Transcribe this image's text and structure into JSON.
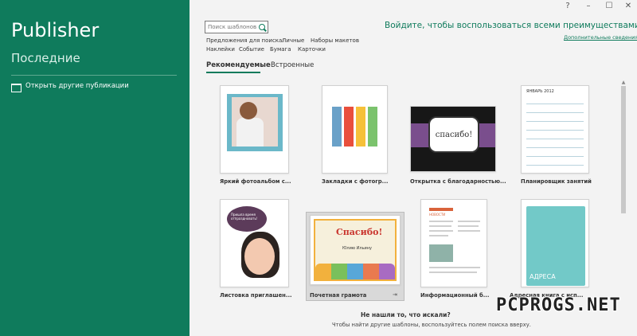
{
  "app": {
    "title": "Publisher",
    "recent_heading": "Последние",
    "open_other": "Открыть другие публикации"
  },
  "window": {
    "help": "?",
    "minimize": "–",
    "maximize": "☐",
    "close": "✕"
  },
  "search": {
    "placeholder": "Поиск шаблонов"
  },
  "signin": {
    "text": "Войдите, чтобы воспользоваться всеми преимуществами Office",
    "details_link": "Дополнительные сведения"
  },
  "suggestions": {
    "label": "Предложения для поиска:",
    "items": [
      "Личные",
      "Наборы макетов",
      "Наклейки",
      "Событие",
      "Бумага",
      "Карточки"
    ]
  },
  "tabs": {
    "recommended": "Рекомендуемые",
    "builtin": "Встроенные"
  },
  "templates": [
    {
      "label": "Яркий фотоальбом с..."
    },
    {
      "label": "Закладки с фотогр..."
    },
    {
      "label": "Открытка с благодарностью..."
    },
    {
      "label": "Планировщик занятий"
    },
    {
      "label": "Листовка приглашен..."
    },
    {
      "label": "Почетная грамота"
    },
    {
      "label": "Информационный б..."
    },
    {
      "label": "Адресная книга с исп..."
    }
  ],
  "thumb_text": {
    "thanks_card": "спасибо!",
    "planner_title": "ЯНВАРЬ 2012",
    "flyer_bubble": "Пришла время отпраздновать!",
    "certificate_title": "Спасибо!",
    "certificate_name": "Юлию Ильину",
    "newsletter_head": "НОВОСТИ",
    "address_book": "АДРЕСА"
  },
  "footer": {
    "not_found": "Не нашли то, что искали?",
    "hint": "Чтобы найти другие шаблоны, воспользуйтесь полем поиска вверху."
  },
  "watermark": "PCPROGS.NET",
  "colors": {
    "accent": "#0f7b5c"
  }
}
